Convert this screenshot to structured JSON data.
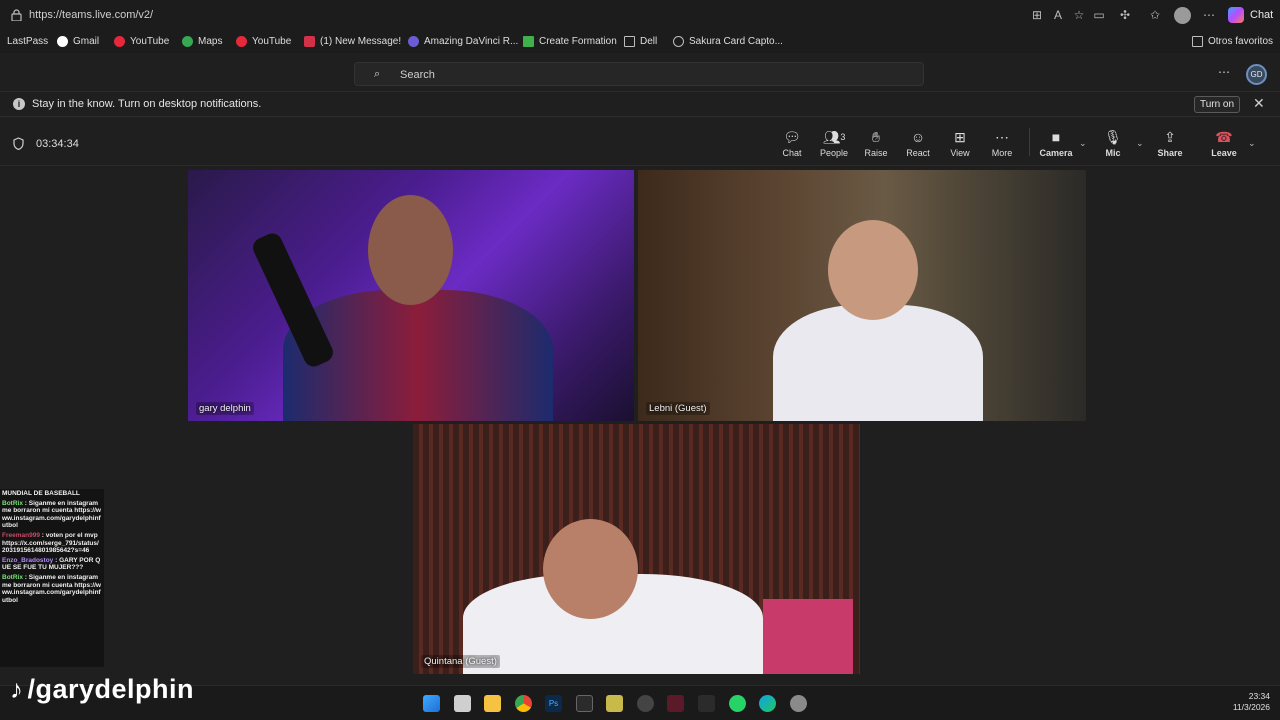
{
  "browser": {
    "url": "https://teams.live.com/v2/",
    "chat_label": "Chat",
    "bookmarks": [
      "LastPass",
      "Gmail",
      "YouTube",
      "Maps",
      "YouTube",
      "(1) New Message!",
      "Amazing DaVinci R...",
      "Create Formation",
      "Dell",
      "Sakura Card Capto..."
    ],
    "other_favorites": "Otros favoritos"
  },
  "teams": {
    "search_placeholder": "Search",
    "avatar_initials": "GD",
    "notification_text": "Stay in the know. Turn on desktop notifications.",
    "turn_on_label": "Turn on"
  },
  "meeting": {
    "timer": "03:34:34",
    "people_count": "3",
    "tools": {
      "chat": "Chat",
      "people": "People",
      "raise": "Raise",
      "react": "React",
      "view": "View",
      "more": "More",
      "camera": "Camera",
      "mic": "Mic",
      "share": "Share",
      "leave": "Leave"
    },
    "participants": [
      "gary delphin",
      "Lebni (Guest)",
      "Quintana (Guest)"
    ]
  },
  "overlay_chat": [
    {
      "user": "",
      "text": "MUNDIAL DE BASEBALL"
    },
    {
      "user": "BotRix",
      "text": ": Siganme en instagram me borraron mi cuenta https://www.instagram.com/garydelphinfutbol"
    },
    {
      "user": "Freeman999",
      "text": ": voten por el mvp https://x.com/serge_791/status/2031915614801985642?s=46"
    },
    {
      "user": "Enzo_Bradostoy",
      "text": ": GARY POR QUE SE FUE TU MUJER???"
    },
    {
      "user": "BotRix",
      "text": ": Siganme en instagram me borraron mi cuenta https://www.instagram.com/garydelphinfutbol"
    }
  ],
  "watermark": "/garydelphin",
  "taskbar": {
    "time": "23:34",
    "date": "11/3/2026"
  },
  "colors": {
    "leave": "#e0505a",
    "accent": "#6f8fbf"
  }
}
